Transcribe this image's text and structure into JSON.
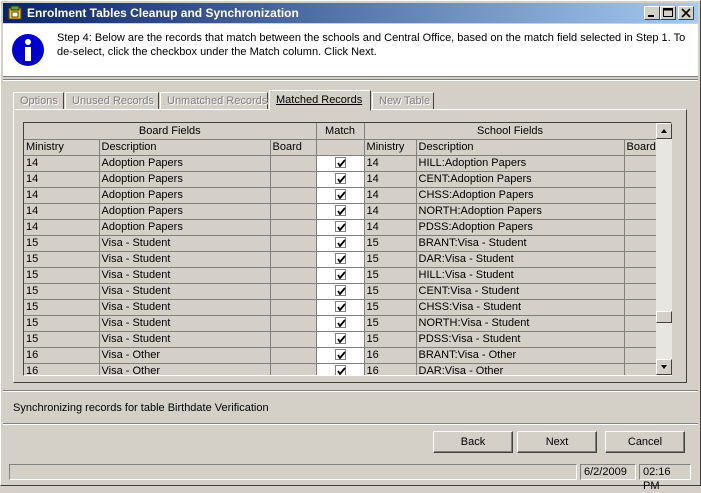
{
  "window": {
    "title": "Enrolment Tables Cleanup and Synchronization"
  },
  "header": {
    "instruction": "Step 4: Below are the records that match between the schools and Central Office, based on the match field selected in Step 1. To de-select, click the checkbox under the Match column. Click Next."
  },
  "tabs": [
    {
      "label": "Options",
      "enabled": false
    },
    {
      "label": "Unused Records",
      "enabled": false
    },
    {
      "label": "Unmatched Records",
      "enabled": false
    },
    {
      "label": "Matched Records",
      "enabled": true,
      "active": true
    },
    {
      "label": "New Table",
      "enabled": false
    }
  ],
  "grid": {
    "group_headers": {
      "board": "Board Fields",
      "match": "Match",
      "school": "School Fields"
    },
    "columns": {
      "ministry": "Ministry",
      "description": "Description",
      "board": "Board",
      "school_ministry": "Ministry",
      "school_description": "Description",
      "school_board": "Board"
    },
    "rows": [
      {
        "ministry": "14",
        "description": "Adoption Papers",
        "board": "",
        "checked": true,
        "school_ministry": "14",
        "school_description": "HILL:Adoption Papers"
      },
      {
        "ministry": "14",
        "description": "Adoption Papers",
        "board": "",
        "checked": true,
        "school_ministry": "14",
        "school_description": "CENT:Adoption Papers"
      },
      {
        "ministry": "14",
        "description": "Adoption Papers",
        "board": "",
        "checked": true,
        "school_ministry": "14",
        "school_description": "CHSS:Adoption Papers"
      },
      {
        "ministry": "14",
        "description": "Adoption Papers",
        "board": "",
        "checked": true,
        "school_ministry": "14",
        "school_description": "NORTH:Adoption Papers"
      },
      {
        "ministry": "14",
        "description": "Adoption Papers",
        "board": "",
        "checked": true,
        "school_ministry": "14",
        "school_description": "PDSS:Adoption Papers"
      },
      {
        "ministry": "15",
        "description": "Visa - Student",
        "board": "",
        "checked": true,
        "school_ministry": "15",
        "school_description": "BRANT:Visa - Student"
      },
      {
        "ministry": "15",
        "description": "Visa - Student",
        "board": "",
        "checked": true,
        "school_ministry": "15",
        "school_description": "DAR:Visa - Student"
      },
      {
        "ministry": "15",
        "description": "Visa - Student",
        "board": "",
        "checked": true,
        "school_ministry": "15",
        "school_description": "HILL:Visa - Student"
      },
      {
        "ministry": "15",
        "description": "Visa - Student",
        "board": "",
        "checked": true,
        "school_ministry": "15",
        "school_description": "CENT:Visa - Student"
      },
      {
        "ministry": "15",
        "description": "Visa - Student",
        "board": "",
        "checked": true,
        "school_ministry": "15",
        "school_description": "CHSS:Visa - Student"
      },
      {
        "ministry": "15",
        "description": "Visa - Student",
        "board": "",
        "checked": true,
        "school_ministry": "15",
        "school_description": "NORTH:Visa - Student"
      },
      {
        "ministry": "15",
        "description": "Visa - Student",
        "board": "",
        "checked": true,
        "school_ministry": "15",
        "school_description": "PDSS:Visa - Student"
      },
      {
        "ministry": "16",
        "description": "Visa - Other",
        "board": "",
        "checked": true,
        "school_ministry": "16",
        "school_description": "BRANT:Visa - Other"
      },
      {
        "ministry": "16",
        "description": "Visa - Other",
        "board": "",
        "checked": true,
        "school_ministry": "16",
        "school_description": "DAR:Visa - Other"
      }
    ]
  },
  "status_message": "Synchronizing records for table Birthdate Verification",
  "buttons": {
    "back": "Back",
    "next": "Next",
    "cancel": "Cancel"
  },
  "statusbar": {
    "date": "6/2/2009",
    "time": "02:16 PM"
  },
  "colors": {
    "titlebar_start": "#0a246a",
    "titlebar_end": "#a6caf0",
    "face": "#d4d0c8",
    "info_icon": "#0000cc"
  },
  "icons": {
    "app": "app-icon",
    "info": "info-icon",
    "minimize": "minimize-icon",
    "maximize": "maximize-icon",
    "close": "close-icon",
    "check": "checkmark-icon"
  }
}
